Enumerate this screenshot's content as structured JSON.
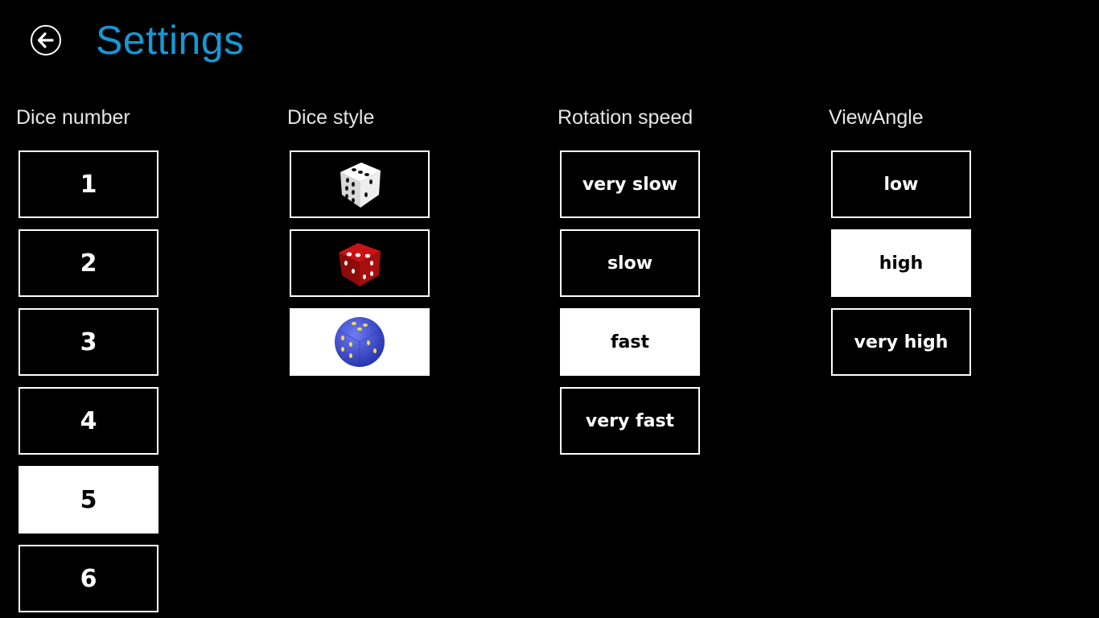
{
  "header": {
    "title": "Settings"
  },
  "groups": {
    "dice_number": {
      "label": "Dice number",
      "options": [
        "1",
        "2",
        "3",
        "4",
        "5",
        "6"
      ],
      "selected": "5"
    },
    "dice_style": {
      "label": "Dice style",
      "options": [
        "white-dice-icon",
        "red-dice-icon",
        "blue-dice-icon"
      ],
      "selected": "blue-dice-icon"
    },
    "rotation_speed": {
      "label": "Rotation speed",
      "options": [
        "very slow",
        "slow",
        "fast",
        "very fast"
      ],
      "selected": "fast"
    },
    "view_angle": {
      "label": "ViewAngle",
      "options": [
        "low",
        "high",
        "very high"
      ],
      "selected": "high"
    }
  },
  "colors": {
    "accent": "#1a96d4",
    "background": "#000000",
    "selected_bg": "#ffffff",
    "white_dice": "#f2f2f2",
    "red_dice": "#b30d0d",
    "blue_dice": "#3c4fd6",
    "blue_dice_pips": "#e8d24a"
  }
}
